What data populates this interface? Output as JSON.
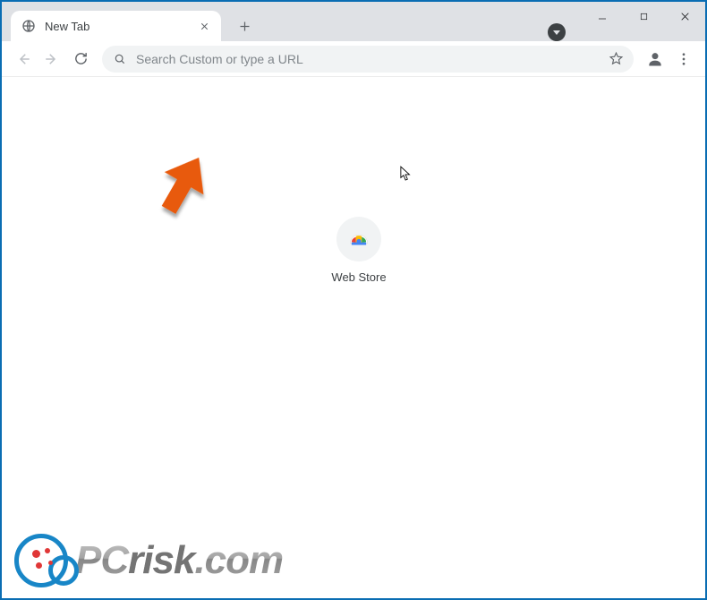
{
  "tab": {
    "title": "New Tab"
  },
  "omnibox": {
    "placeholder": "Search Custom or type a URL"
  },
  "shortcut": {
    "label": "Web Store"
  },
  "watermark": {
    "text1": "PC",
    "text2": "risk",
    "text3": ".com"
  },
  "colors": {
    "window_border": "#0a6db3",
    "annotation_arrow": "#e85a0c"
  }
}
